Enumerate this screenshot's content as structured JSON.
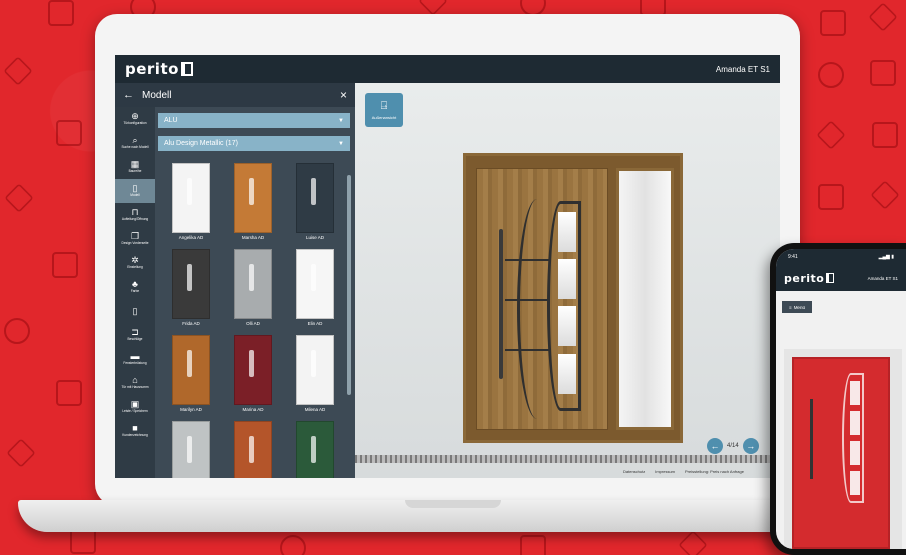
{
  "app": {
    "brand": "perito",
    "product_name": "Amanda ET S1"
  },
  "panel": {
    "title": "Modell",
    "back_icon": "arrow-left-icon",
    "close_icon": "close-icon",
    "material_select": "ALU",
    "design_select": "Alu Design Metallic (17)"
  },
  "rail": [
    {
      "icon": "plus-circle-icon",
      "glyph": "⊕",
      "label": "Türkonfiguration"
    },
    {
      "icon": "search-icon",
      "glyph": "⌕",
      "label": "Suche nach Modell"
    },
    {
      "icon": "layers-icon",
      "glyph": "▦",
      "label": "Baureihe"
    },
    {
      "icon": "door-icon",
      "glyph": "▯",
      "label": "Modell",
      "active": true
    },
    {
      "icon": "frame-icon",
      "glyph": "⊓",
      "label": "Aufteilung/Öffnung"
    },
    {
      "icon": "copy-icon",
      "glyph": "❐",
      "label": "Design Vorderseite"
    },
    {
      "icon": "gear-icon",
      "glyph": "✲",
      "label": "Einstellung"
    },
    {
      "icon": "paint-icon",
      "glyph": "♣",
      "label": "Farbe"
    },
    {
      "icon": "glass-icon",
      "glyph": "▯",
      "label": ""
    },
    {
      "icon": "handle-icon",
      "glyph": "⊐",
      "label": "Beschläge"
    },
    {
      "icon": "mail-icon",
      "glyph": "▬",
      "label": "Fensterbrüstung"
    },
    {
      "icon": "house-icon",
      "glyph": "⌂",
      "label": "Tür mit Hausnumm"
    },
    {
      "icon": "image-icon",
      "glyph": "▣",
      "label": "Leiste / Speichern"
    },
    {
      "icon": "lock-icon",
      "glyph": "■",
      "label": "Kundenzeichnung"
    }
  ],
  "models": [
    {
      "name": "Angelika AD",
      "color": "#f4f4f4"
    },
    {
      "name": "Marsha AD",
      "color": "#c47a36"
    },
    {
      "name": "Luise AD",
      "color": "#2f3b45"
    },
    {
      "name": "Frida AD",
      "color": "#3a3a3a"
    },
    {
      "name": "Olli AD",
      "color": "#a8acae"
    },
    {
      "name": "Elin AD",
      "color": "#f6f6f6"
    },
    {
      "name": "Marilyn AD",
      "color": "#b0682b"
    },
    {
      "name": "Marina AD",
      "color": "#7b1f27"
    },
    {
      "name": "Milena AD",
      "color": "#f3f3f3"
    },
    {
      "name": "",
      "color": "#bfc3c4"
    },
    {
      "name": "",
      "color": "#b4552a"
    },
    {
      "name": "",
      "color": "#2b5a3a"
    }
  ],
  "scene": {
    "view_button_label": "Außenansicht",
    "view_button_icon": "door-exit-icon",
    "pager": "4/14",
    "footer_links": [
      "Datenschutz",
      "Impressum",
      "Preisstellung: Preis nach Anfrage"
    ]
  },
  "phone": {
    "time": "9:41",
    "menu_label": "Menü",
    "product_name": "Amanda ET S1",
    "door_color": "#d42b2e"
  }
}
